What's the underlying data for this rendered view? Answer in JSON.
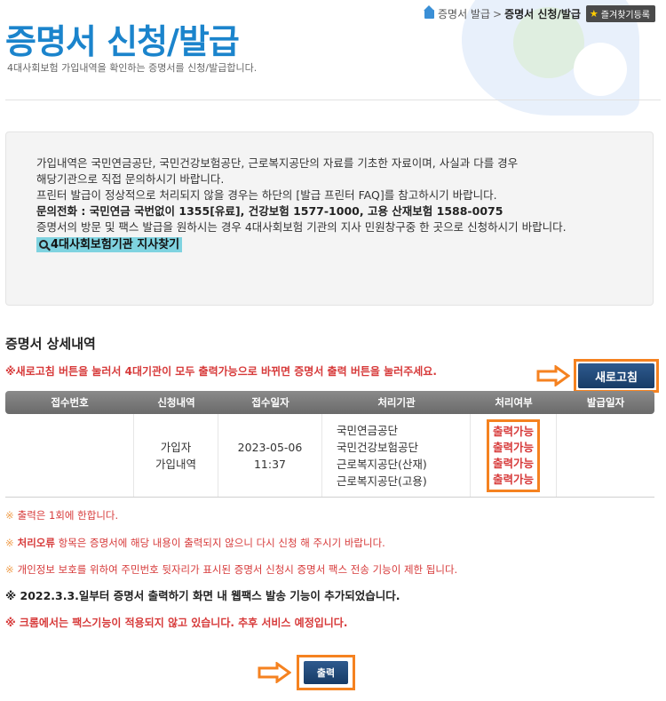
{
  "breadcrumb": {
    "home": "증명서 발급",
    "separator": ">",
    "current": "증명서 신청/발급",
    "favorite_label": "즐겨찾기등록"
  },
  "header": {
    "title": "증명서 신청/발급",
    "subtitle": "4대사회보험 가입내역을 확인하는 증명서를 신청/발급합니다."
  },
  "info": {
    "line1": "가입내역은 국민연금공단, 국민건강보험공단, 근로복지공단의 자료를 기초한 자료이며, 사실과 다를 경우",
    "line2": "해당기관으로 직접 문의하시기 바랍니다.",
    "line3": "프린터 발급이 정상적으로 처리되지 않을 경우는 하단의 [발급 프린터 FAQ]를 참고하시기 바랍니다.",
    "phone": "문의전화 : 국민연금 국번없이 1355[유료], 건강보험 1577-1000, 고용 산재보험 1588-0075",
    "fax": "증명서의 방문 및 팩스 발급을 원하시는 경우 4대사회보험 기관의 지사 민원창구중 한 곳으로 신청하시기 바랍니다.",
    "branch_link": "4대사회보험기관 지사찾기"
  },
  "section": {
    "title": "증명서 상세내역",
    "notice": "※새로고침 버튼을 눌러서 4대기관이 모두 출력가능으로 바뀌면 증명서 출력 버튼을 눌러주세요.",
    "refresh_label": "새로고침"
  },
  "table": {
    "headers": [
      "접수번호",
      "신청내역",
      "접수일자",
      "처리기관",
      "처리여부",
      "발급일자"
    ],
    "row": {
      "receipt_no": "",
      "request_line1": "가입자",
      "request_line2": "가입내역",
      "date": "2023-05-06",
      "time": "11:37",
      "agencies": [
        "국민연금공단",
        "국민건강보험공단",
        "근로복지공단(산재)",
        "근로복지공단(고용)"
      ],
      "statuses": [
        "출력가능",
        "출력가능",
        "출력가능",
        "출력가능"
      ],
      "issue_date": ""
    }
  },
  "notes": {
    "mark": "※",
    "n1": "출력은 1회에 한합니다.",
    "n2_bold": "처리오류",
    "n2_rest": " 항목은 증명서에 해당 내용이 출력되지 않으니 다시 신청 해 주시기 바랍니다.",
    "n3": "개인정보 보호를 위하여 주민번호 뒷자리가 표시된 증명서 신청시 증명서 팩스 전송 기능이 제한 됩니다.",
    "n4": "※ 2022.3.3.일부터 증명서 출력하기 화면 내 웹팩스 발송 기능이 추가되었습니다.",
    "n5": "※ 크롬에서는 팩스기능이 적용되지 않고 있습니다. 추후 서비스 예정입니다."
  },
  "print_label": "출력",
  "colors": {
    "title_blue": "#1b84cc",
    "highlight_orange": "#f58220",
    "notice_red": "#d73a3a",
    "button_navy": "#1f4a7c"
  }
}
